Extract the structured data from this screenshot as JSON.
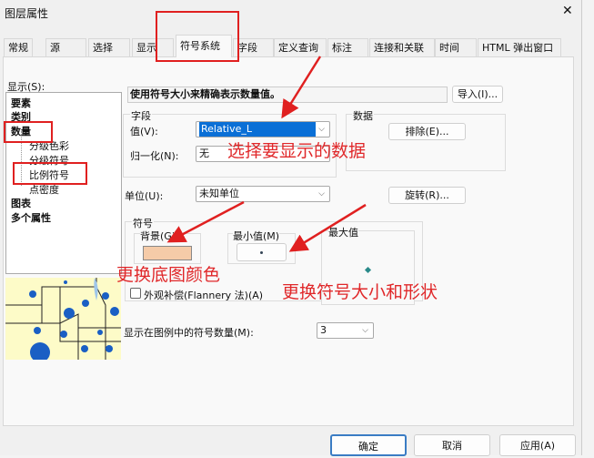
{
  "window": {
    "title": "图层属性",
    "close": "✕"
  },
  "tabs": [
    "常规",
    "源",
    "选择",
    "显示",
    "符号系统",
    "字段",
    "定义查询",
    "标注",
    "连接和关联",
    "时间",
    "HTML 弹出窗口"
  ],
  "show_label": "显示(S):",
  "tree": [
    {
      "label": "要素",
      "bold": true
    },
    {
      "label": "类别",
      "bold": true
    },
    {
      "label": "数量",
      "bold": true
    },
    {
      "label": "分级色彩"
    },
    {
      "label": "分级符号"
    },
    {
      "label": "比例符号"
    },
    {
      "label": "点密度"
    },
    {
      "label": "图表",
      "bold": true
    },
    {
      "label": "多个属性",
      "bold": true
    }
  ],
  "description": "使用符号大小来精确表示数量值。",
  "import_button": "导入(I)...",
  "field_group": {
    "title": "字段",
    "value_label": "值(V):",
    "value": "Relative_L",
    "normalize_label": "归一化(N):",
    "normalize": "无"
  },
  "data_group": {
    "title": "数据",
    "exclude_button": "排除(E)..."
  },
  "units": {
    "label": "单位(U):",
    "value": "未知单位"
  },
  "rotate_button": "旋转(R)...",
  "symbol_group": {
    "title": "符号",
    "background_label": "背景(G)",
    "background_color": "#f5cba8",
    "min_label": "最小值(M)",
    "max_label": "最大值",
    "flannery_label": "外观补偿(Flannery 法)(A)",
    "flannery_checked": false
  },
  "legend_count": {
    "label": "显示在图例中的符号数量(M):",
    "value": "3"
  },
  "buttons": {
    "ok": "确定",
    "cancel": "取消",
    "apply": "应用(A)"
  },
  "annotations": {
    "select_data": "选择要显示的数据",
    "change_bg": "更换底图颜色",
    "change_symbol": "更换符号大小和形状"
  }
}
